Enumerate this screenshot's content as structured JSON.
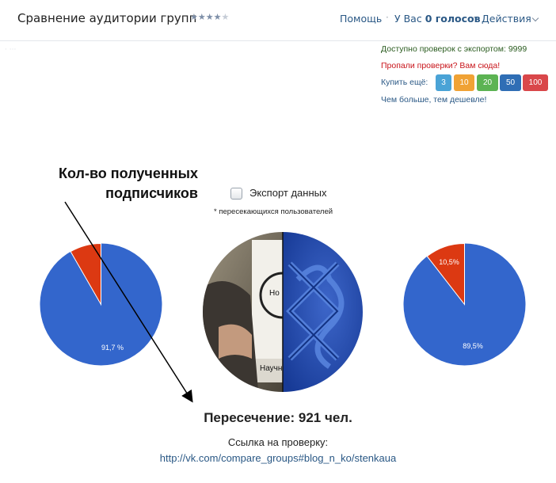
{
  "header": {
    "title": "Сравнение аудитории групп",
    "rating_stars": 4,
    "rating_max": 5,
    "help_link": "Помощь",
    "votes_prefix": "У Вас",
    "votes_value": "0 голосов",
    "actions_link": "Действия"
  },
  "sidebar": {
    "faint_text": "· ··· "
  },
  "checks_panel": {
    "available_label": "Доступно проверок с экспортом:",
    "available_value": "9999",
    "lost_checks_link": "Пропали проверки? Вам сюда!",
    "buy_more_label": "Купить ещё:",
    "buy_options": [
      {
        "label": "3",
        "color": "#4aa3d6"
      },
      {
        "label": "10",
        "color": "#f0a235"
      },
      {
        "label": "20",
        "color": "#5cb353"
      },
      {
        "label": "50",
        "color": "#2f6eb5"
      },
      {
        "label": "100",
        "color": "#d9474a"
      }
    ],
    "cheaper_note": "Чем больше, тем дешевле!"
  },
  "annotation": {
    "line1": "Кол-во полученных",
    "line2": "подписчиков"
  },
  "export": {
    "checkbox_label": "Экспорт данных",
    "checked": false,
    "note": "* пересекающихся пользователей"
  },
  "pies": [
    {
      "name": "group-1",
      "labels": [
        "91,7 %",
        ""
      ],
      "values": [
        91.7,
        8.3
      ],
      "colors": [
        "#3366cc",
        "#dc3912"
      ]
    },
    {
      "name": "group-2",
      "labels": [
        "89,5%",
        "10,5%"
      ],
      "values": [
        89.5,
        10.5
      ],
      "colors": [
        "#3366cc",
        "#dc3912"
      ]
    }
  ],
  "avatar": {
    "left_text_1": "Но",
    "left_text_2": "Научн",
    "colors": {
      "left_bg": "#8a8270",
      "right_bg": "#1f46a8"
    }
  },
  "result": {
    "intersection_text": "Пересечение: 921 чел.",
    "link_label": "Ссылка на проверку:",
    "link_url": "http://vk.com/compare_groups#blog_n_ko/stenkaua"
  },
  "colors": {
    "link": "#2a5885",
    "brand_blue": "#3366cc",
    "brand_red": "#dc3912"
  }
}
